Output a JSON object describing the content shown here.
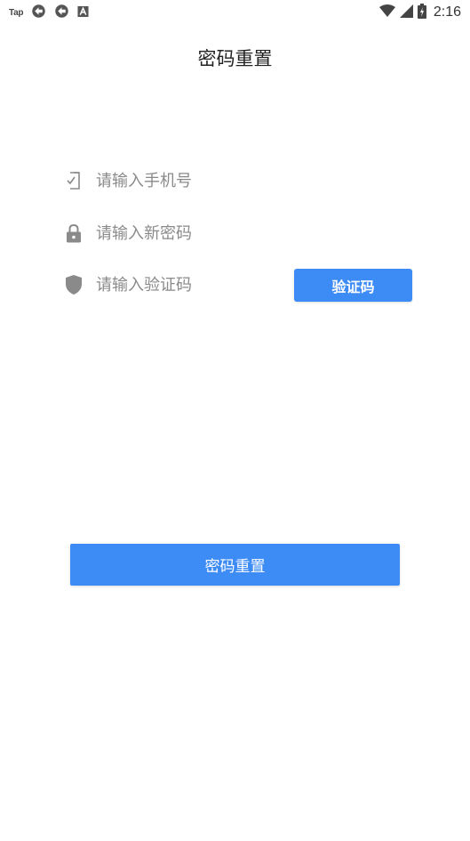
{
  "status_bar": {
    "app_label": "Tap",
    "time": "2:16",
    "icons": [
      "tap-label",
      "sync-icon",
      "sync-icon",
      "font-a-icon",
      "wifi-icon",
      "signal-icon",
      "battery-charging-icon"
    ]
  },
  "header": {
    "title": "密码重置"
  },
  "form": {
    "phone": {
      "placeholder": "请输入手机号",
      "value": "",
      "icon": "phone-icon"
    },
    "password": {
      "placeholder": "请输入新密码",
      "value": "",
      "icon": "lock-icon"
    },
    "code": {
      "placeholder": "请输入验证码",
      "value": "",
      "icon": "shield-icon",
      "button_label": "验证码"
    }
  },
  "submit": {
    "label": "密码重置"
  },
  "colors": {
    "accent": "#3d8bf5",
    "icon_gray": "#8a8a8a",
    "text": "#333333"
  }
}
